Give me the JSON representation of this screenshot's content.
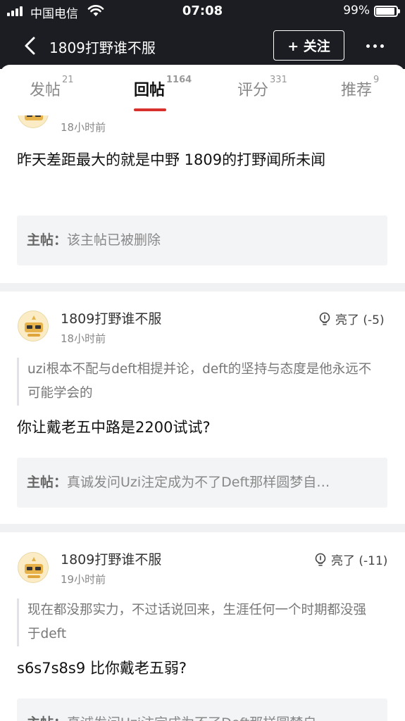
{
  "status": {
    "carrier": "中国电信",
    "time": "07:08",
    "battery": "99%",
    "battery_level": 0.99
  },
  "nav": {
    "title": "1809打野谁不服",
    "follow_label": "+ 关注"
  },
  "tabs": [
    {
      "label": "发帖",
      "count": "21"
    },
    {
      "label": "回帖",
      "count": "1164"
    },
    {
      "label": "评分",
      "count": "331"
    },
    {
      "label": "推荐",
      "count": "9"
    }
  ],
  "posts": [
    {
      "time": "18小时前",
      "text": "昨天差距最大的就是中野 1809的打野闻所未闻",
      "ref_label": "主帖：",
      "ref_text": "该主帖已被删除"
    },
    {
      "user": "1809打野谁不服",
      "time": "18小时前",
      "light": "亮了 (-5)",
      "quote": "uzi根本不配与deft相提并论，deft的坚持与态度是他永远不可能学会的",
      "text": "你让戴老五中路是2200试试?",
      "ref_label": "主帖：",
      "ref_text": "真诚发问Uzi注定成为不了Deft那样圆梦自…"
    },
    {
      "user": "1809打野谁不服",
      "time": "19小时前",
      "light": "亮了 (-11)",
      "quote": "现在都没那实力，不过话说回来，生涯任何一个时期都没强于deft",
      "text": "s6s7s8s9 比你戴老五弱?",
      "ref_label": "主帖：",
      "ref_text": "真诚发问Uzi注定成为不了Deft那样圆梦自…"
    }
  ]
}
